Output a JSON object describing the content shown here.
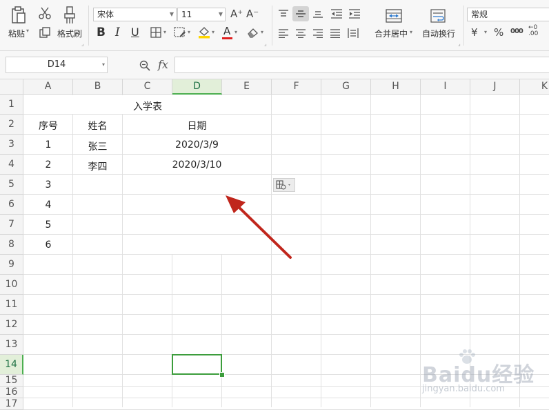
{
  "ribbon": {
    "paste_label": "粘贴",
    "format_painter_label": "格式刷",
    "font_name": "宋体",
    "font_size": "11",
    "grow_font": "A⁺",
    "shrink_font": "A⁻",
    "bold": "B",
    "italic": "I",
    "underline": "U",
    "font_color_glyph": "A",
    "merge_label": "合并居中",
    "wrap_label": "自动换行",
    "number_format": "常规",
    "currency": "¥",
    "percent": "%",
    "thousands": "000",
    "decimal": "←0 .00",
    "accent_red": "#e02020",
    "accent_yellow": "#ffd600"
  },
  "formula_bar": {
    "name_box": "D14",
    "zoom_icon": "zoom-icon",
    "fx_label": "fx",
    "value": ""
  },
  "grid": {
    "columns": [
      "A",
      "B",
      "C",
      "D",
      "E",
      "F",
      "G",
      "H",
      "I",
      "J",
      "K"
    ],
    "rows": [
      "1",
      "2",
      "3",
      "4",
      "5",
      "6",
      "7",
      "8",
      "9",
      "10",
      "11",
      "12",
      "13",
      "14",
      "15",
      "16",
      "17"
    ],
    "selected_column": "D",
    "selected_row": "14",
    "selection_color": "#3c9d3c"
  },
  "sheet": {
    "title": "入学表",
    "header_seq": "序号",
    "header_name": "姓名",
    "header_date": "日期",
    "rows": [
      {
        "seq": "1",
        "name": "张三",
        "date": "2020/3/9"
      },
      {
        "seq": "2",
        "name": "李四",
        "date": "2020/3/10"
      },
      {
        "seq": "3",
        "name": "",
        "date": ""
      },
      {
        "seq": "4",
        "name": "",
        "date": ""
      },
      {
        "seq": "5",
        "name": "",
        "date": ""
      },
      {
        "seq": "6",
        "name": "",
        "date": ""
      }
    ]
  },
  "annotation": {
    "arrow_color": "#c0261c"
  },
  "watermark": {
    "brand": "Baidu经验",
    "url": "jingyan.baidu.com"
  }
}
